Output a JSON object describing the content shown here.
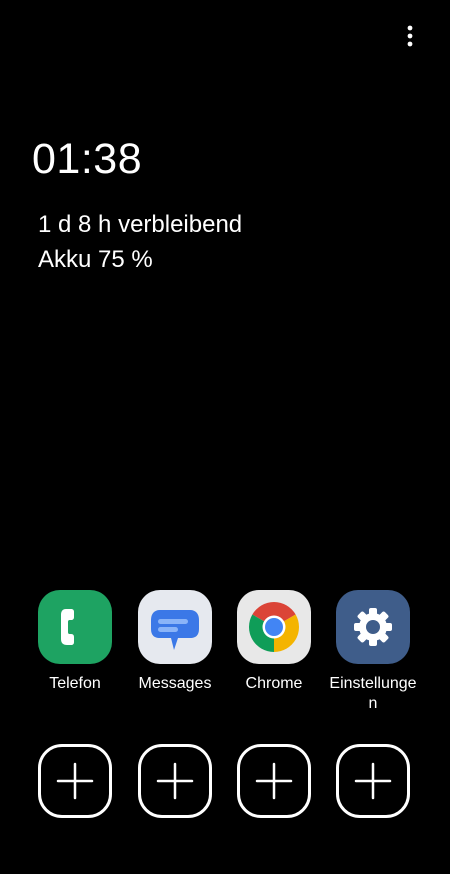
{
  "colors": {
    "background": "#000000",
    "text": "#ffffff",
    "phone": "#1ea362",
    "messages_bg": "#e6e9ef",
    "messages_bubble": "#3b78e7",
    "chrome_bg": "#e8e8e8",
    "settings_bg": "#3f5d8a"
  },
  "header": {
    "menu_icon": "more-vertical-icon"
  },
  "status": {
    "time": "01:38",
    "remaining": "1 d 8 h verbleibend",
    "battery": "Akku 75 %"
  },
  "apps": [
    {
      "label": "Telefon",
      "icon": "phone-icon"
    },
    {
      "label": "Messages",
      "icon": "messages-icon"
    },
    {
      "label": "Chrome",
      "icon": "chrome-icon"
    },
    {
      "label": "Einstellungen",
      "icon": "settings-icon"
    }
  ],
  "add_slots": [
    {
      "icon": "plus-icon"
    },
    {
      "icon": "plus-icon"
    },
    {
      "icon": "plus-icon"
    },
    {
      "icon": "plus-icon"
    }
  ]
}
